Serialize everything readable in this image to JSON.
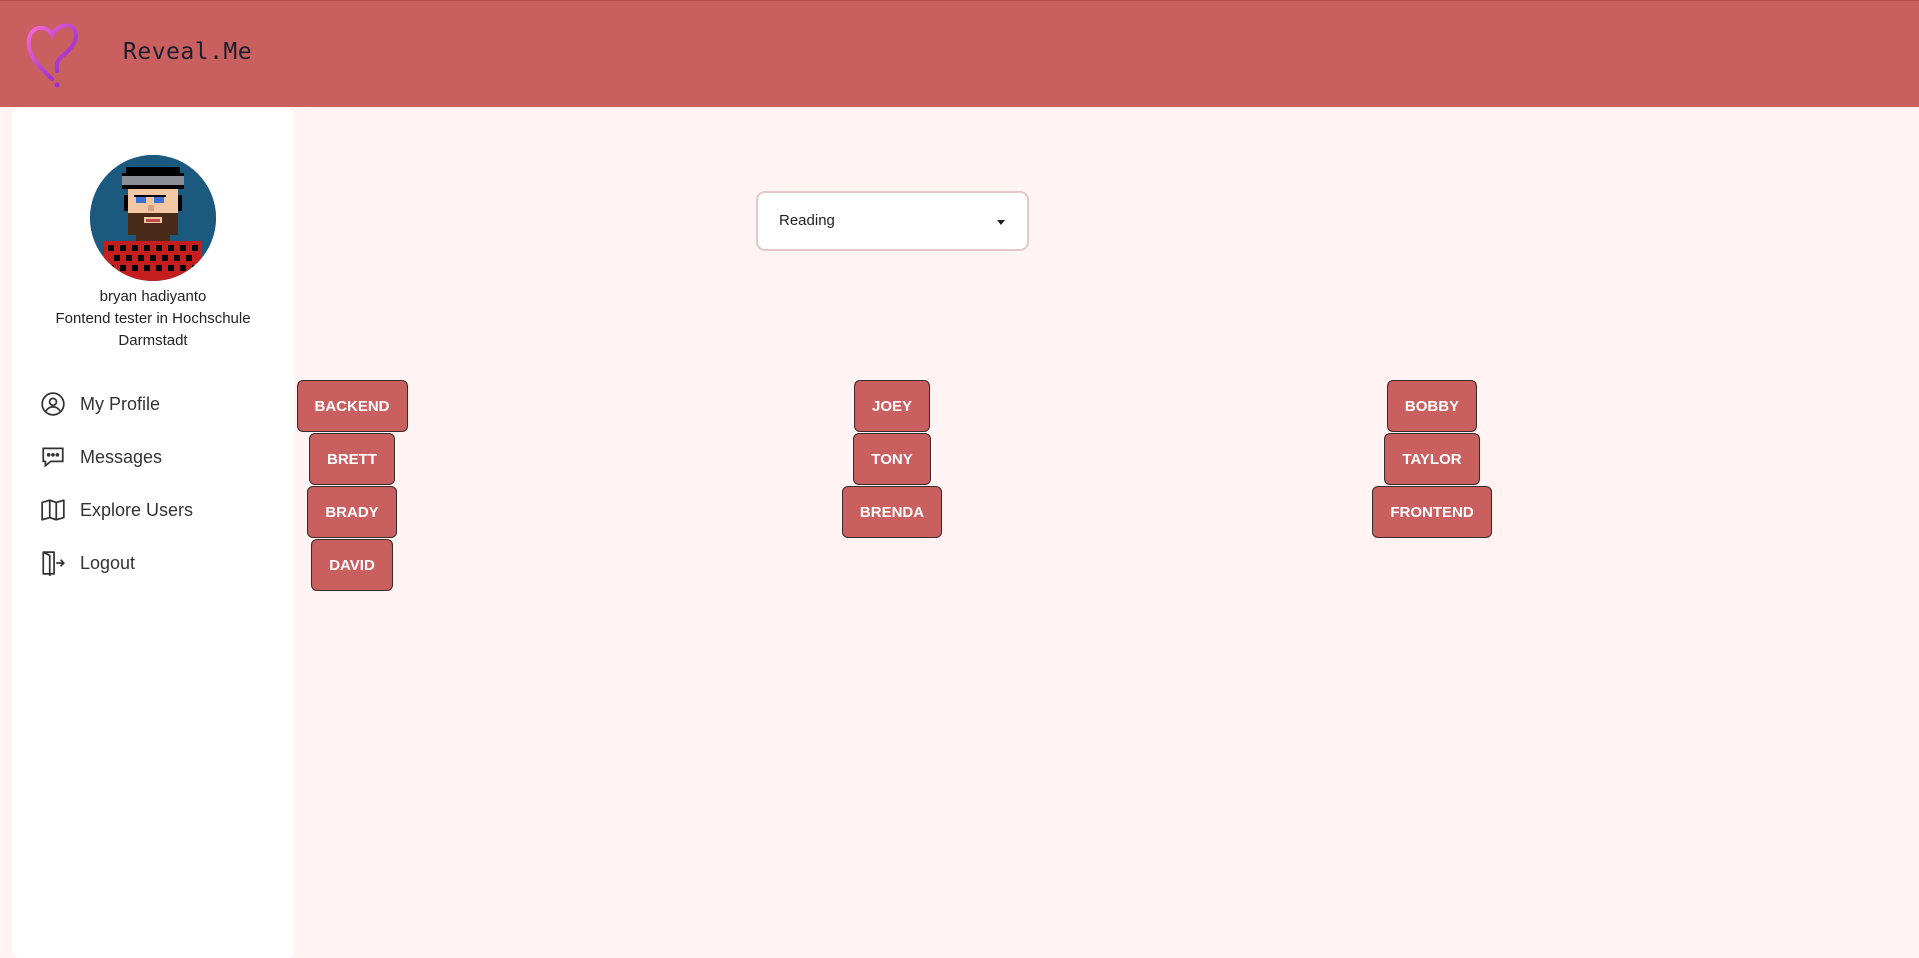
{
  "header": {
    "brand": "Reveal.Me",
    "logo_icon": "heart-question-icon",
    "background_color": "#ca5f60"
  },
  "profile": {
    "name": "bryan hadiyanto",
    "bio": "Fontend tester in Hochschule Darmstadt"
  },
  "nav": {
    "items": [
      {
        "label": "My Profile",
        "icon": "user-circle-icon"
      },
      {
        "label": "Messages",
        "icon": "chat-bubble-icon"
      },
      {
        "label": "Explore Users",
        "icon": "map-icon"
      },
      {
        "label": "Logout",
        "icon": "logout-door-icon"
      }
    ]
  },
  "filter": {
    "selected": "Reading"
  },
  "columns": [
    {
      "tags": [
        "BACKEND",
        "BRETT",
        "BRADY",
        "DAVID"
      ]
    },
    {
      "tags": [
        "JOEY",
        "TONY",
        "BRENDA"
      ]
    },
    {
      "tags": [
        "BOBBY",
        "TAYLOR",
        "FRONTEND"
      ]
    }
  ]
}
